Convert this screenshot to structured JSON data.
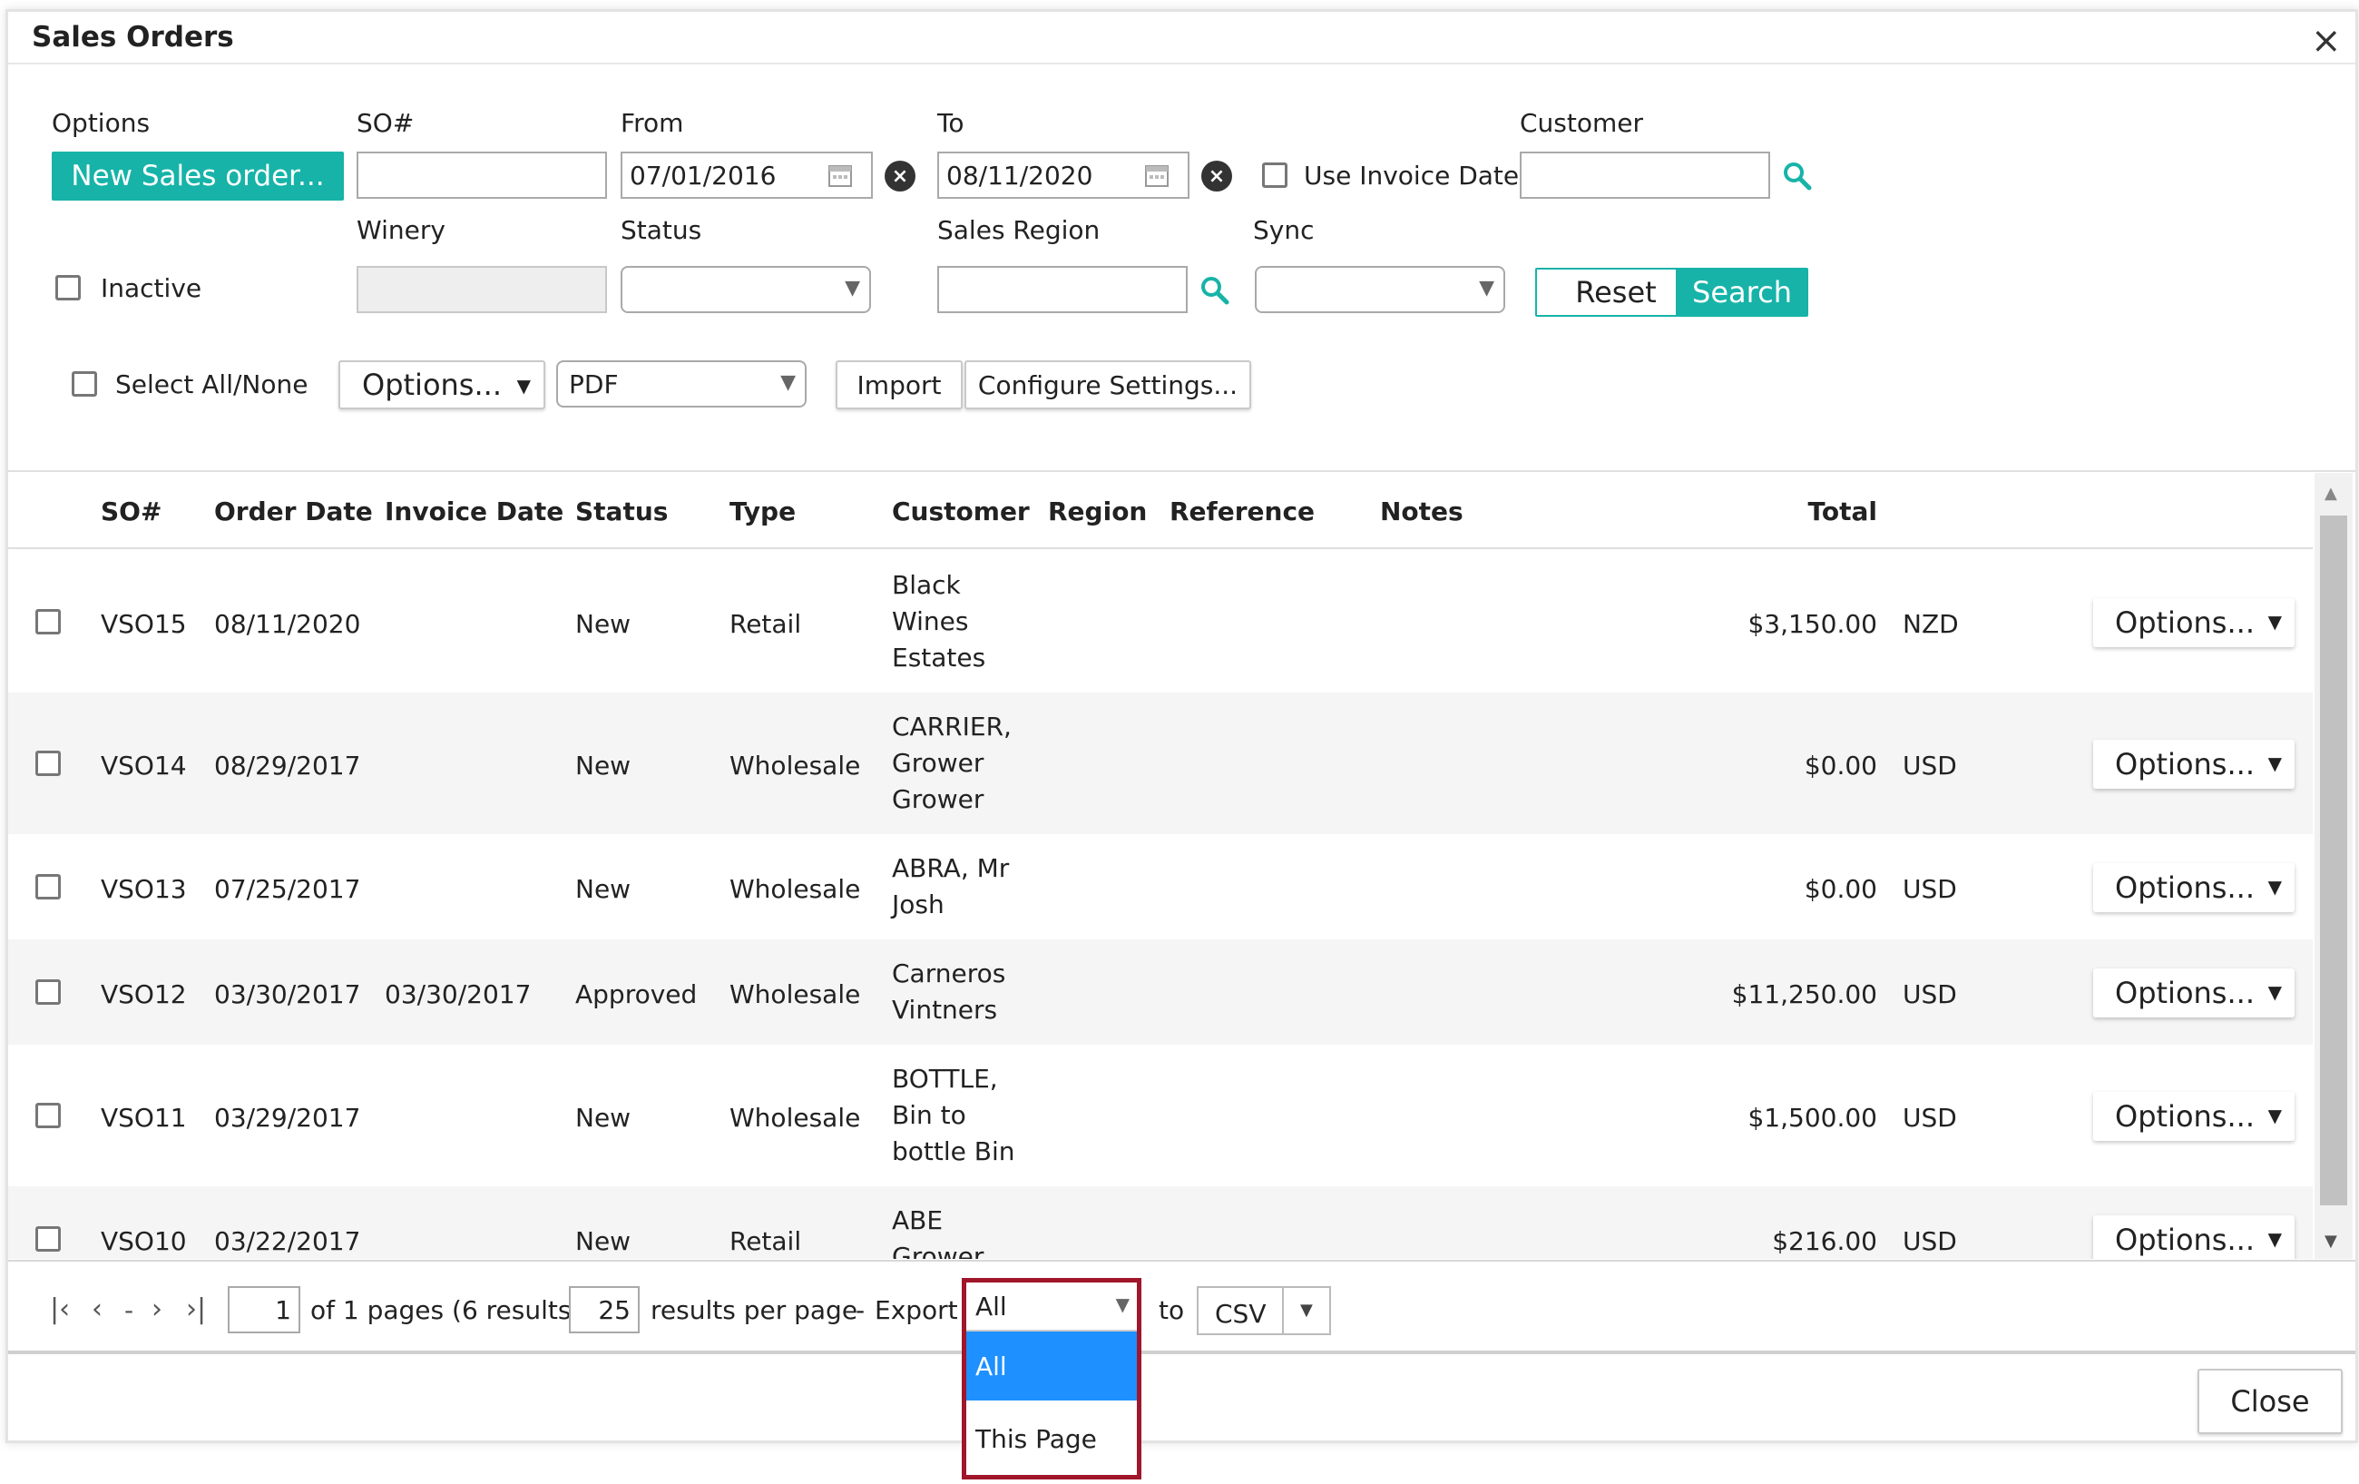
{
  "dialog": {
    "title": "Sales Orders",
    "close_icon": "×"
  },
  "filters": {
    "options_label": "Options",
    "new_order_button": "New Sales order...",
    "so_label": "SO#",
    "so_value": "",
    "from_label": "From",
    "from_value": "07/01/2016",
    "to_label": "To",
    "to_value": "08/11/2020",
    "use_invoice_date_label": "Use Invoice Date",
    "customer_label": "Customer",
    "customer_value": "",
    "inactive_label": "Inactive",
    "winery_label": "Winery",
    "status_label": "Status",
    "status_value": "",
    "sales_region_label": "Sales Region",
    "sales_region_value": "",
    "sync_label": "Sync",
    "sync_value": "",
    "reset_button": "Reset",
    "search_button": "Search"
  },
  "toolbar": {
    "select_all_label": "Select All/None",
    "options_button": "Options...",
    "format_value": "PDF",
    "import_button": "Import",
    "configure_button": "Configure Settings..."
  },
  "table": {
    "headers": {
      "so": "SO#",
      "order_date": "Order Date",
      "invoice_date": "Invoice Date",
      "status": "Status",
      "type": "Type",
      "customer": "Customer",
      "region": "Region",
      "reference": "Reference",
      "notes": "Notes",
      "total": "Total"
    },
    "row_options_label": "Options...",
    "rows": [
      {
        "so": "VSO15",
        "order_date": "08/11/2020",
        "invoice_date": "",
        "status": "New",
        "type": "Retail",
        "customer": "Black Wines Estates",
        "total": "$3,150.00",
        "currency": "NZD"
      },
      {
        "so": "VSO14",
        "order_date": "08/29/2017",
        "invoice_date": "",
        "status": "New",
        "type": "Wholesale",
        "customer": "CARRIER, Grower Grower",
        "total": "$0.00",
        "currency": "USD"
      },
      {
        "so": "VSO13",
        "order_date": "07/25/2017",
        "invoice_date": "",
        "status": "New",
        "type": "Wholesale",
        "customer": "ABRA, Mr Josh",
        "total": "$0.00",
        "currency": "USD"
      },
      {
        "so": "VSO12",
        "order_date": "03/30/2017",
        "invoice_date": "03/30/2017",
        "status": "Approved",
        "type": "Wholesale",
        "customer": "Carneros Vintners",
        "total": "$11,250.00",
        "currency": "USD"
      },
      {
        "so": "VSO11",
        "order_date": "03/29/2017",
        "invoice_date": "",
        "status": "New",
        "type": "Wholesale",
        "customer": "BOTTLE, Bin to bottle Bin",
        "total": "$1,500.00",
        "currency": "USD"
      },
      {
        "so": "VSO10",
        "order_date": "03/22/2017",
        "invoice_date": "",
        "status": "New",
        "type": "Retail",
        "customer": "ABE Grower",
        "total": "$216.00",
        "currency": "USD"
      }
    ]
  },
  "pager": {
    "page_value": "1",
    "pages_text": "of 1 pages (6 results).",
    "per_page_value": "25",
    "per_page_text": "results per page",
    "dash": "-",
    "export_label": "Export",
    "export_scope_value": "All",
    "to_label": "to",
    "export_format_value": "CSV",
    "dropdown_options": [
      "All",
      "This Page"
    ]
  },
  "footer": {
    "close_button": "Close"
  }
}
